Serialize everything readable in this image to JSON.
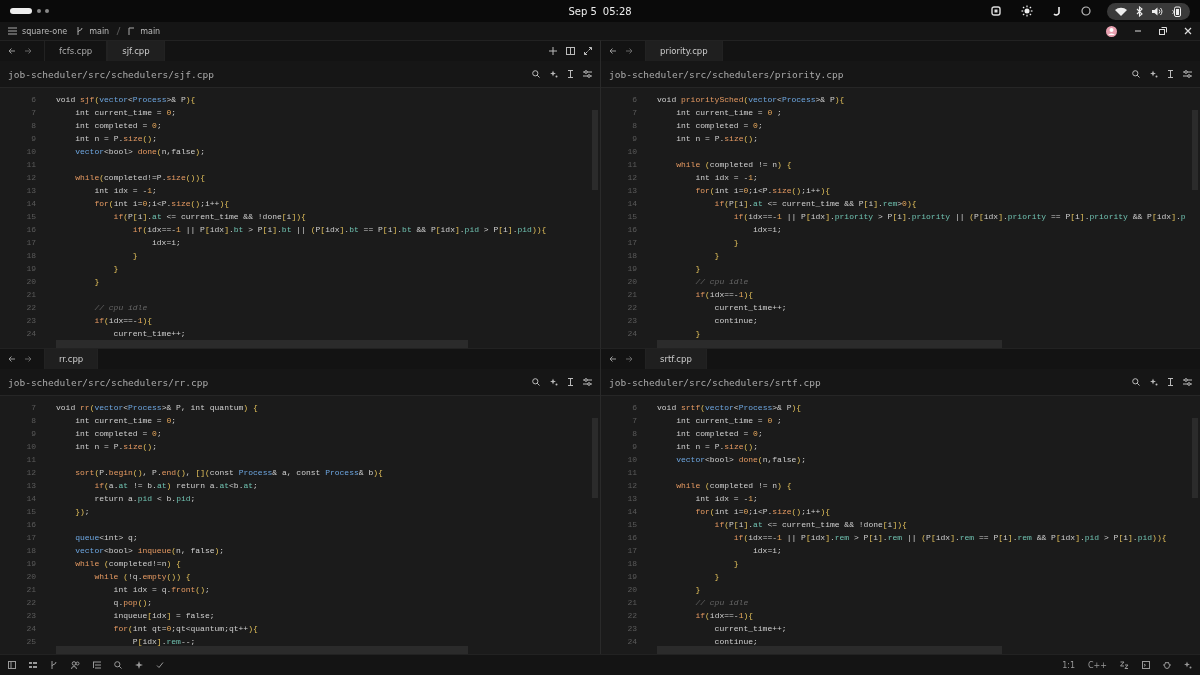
{
  "system_bar": {
    "date": "Sep 5",
    "time": "05:28"
  },
  "title_bar": {
    "project": "square-one",
    "branch": "main",
    "worktree": "main"
  },
  "panes": [
    {
      "tabs": [
        {
          "label": "fcfs.cpp",
          "selected": false
        },
        {
          "label": "sjf.cpp",
          "selected": true
        }
      ],
      "tab_actions": true,
      "path": "job-scheduler/src/schedulers/sjf.cpp",
      "lines": [
        {
          "number": "6",
          "code": "void sjf(vector<Process>& P){"
        },
        {
          "number": "7",
          "code": "    int current_time = 0;"
        },
        {
          "number": "8",
          "code": "    int completed = 0;"
        },
        {
          "number": "9",
          "code": "    int n = P.size();"
        },
        {
          "number": "10",
          "code": "    vector<bool> done(n,false);"
        },
        {
          "number": "11"
        },
        {
          "number": "12",
          "code": "    while(completed!=P.size()){"
        },
        {
          "number": "13",
          "code": "        int idx = -1;"
        },
        {
          "number": "14",
          "code": "        for(int i=0;i<P.size();i++){"
        },
        {
          "number": "15",
          "code": "            if(P[i].at <= current_time && !done[i]){"
        },
        {
          "number": "16",
          "code": "                if(idx==-1 || P[idx].bt > P[i].bt || (P[idx].bt == P[i].bt && P[idx].pid > P[i].pid)){"
        },
        {
          "number": "17",
          "code": "                    idx=i;"
        },
        {
          "number": "18",
          "code": "                }"
        },
        {
          "number": "19",
          "code": "            }"
        },
        {
          "number": "20",
          "code": "        }"
        },
        {
          "number": "21"
        },
        {
          "number": "22",
          "code": "        // cpu idle"
        },
        {
          "number": "23",
          "code": "        if(idx==-1){"
        },
        {
          "number": "24",
          "code": "            current_time++;"
        }
      ]
    },
    {
      "tabs": [
        {
          "label": "priority.cpp",
          "selected": true
        }
      ],
      "tab_actions": false,
      "path": "job-scheduler/src/schedulers/priority.cpp",
      "lines": [
        {
          "number": "6",
          "code": "void prioritySched(vector<Process>& P){"
        },
        {
          "number": "7",
          "code": "    int current_time = 0 ;"
        },
        {
          "number": "8",
          "code": "    int completed = 0;"
        },
        {
          "number": "9",
          "code": "    int n = P.size();"
        },
        {
          "number": "10"
        },
        {
          "number": "11",
          "code": "    while (completed != n) {"
        },
        {
          "number": "12",
          "code": "        int idx = -1;"
        },
        {
          "number": "13",
          "code": "        for(int i=0;i<P.size();i++){"
        },
        {
          "number": "14",
          "code": "            if(P[i].at <= current_time && P[i].rem>0){"
        },
        {
          "number": "15",
          "code": "                if(idx==-1 || P[idx].priority > P[i].priority || (P[idx].priority == P[i].priority && P[idx].p"
        },
        {
          "number": "16",
          "code": "                    idx=i;"
        },
        {
          "number": "17",
          "code": "                }"
        },
        {
          "number": "18",
          "code": "            }"
        },
        {
          "number": "19",
          "code": "        }"
        },
        {
          "number": "20",
          "code": "        // cpu idle"
        },
        {
          "number": "21",
          "code": "        if(idx==-1){"
        },
        {
          "number": "22",
          "code": "            current_time++;"
        },
        {
          "number": "23",
          "code": "            continue;"
        },
        {
          "number": "24",
          "code": "        }"
        }
      ]
    },
    {
      "tabs": [
        {
          "label": "rr.cpp",
          "selected": true
        }
      ],
      "tab_actions": false,
      "path": "job-scheduler/src/schedulers/rr.cpp",
      "lines": [
        {
          "number": "7",
          "code": "void rr(vector<Process>& P, int quantum) {"
        },
        {
          "number": "8",
          "code": "    int current_time = 0;"
        },
        {
          "number": "9",
          "code": "    int completed = 0;"
        },
        {
          "number": "10",
          "code": "    int n = P.size();"
        },
        {
          "number": "11"
        },
        {
          "number": "12",
          "code": "    sort(P.begin(), P.end(), [](const Process& a, const Process& b){"
        },
        {
          "number": "13",
          "code": "        if(a.at != b.at) return a.at<b.at;"
        },
        {
          "number": "14",
          "code": "        return a.pid < b.pid;"
        },
        {
          "number": "15",
          "code": "    });"
        },
        {
          "number": "16"
        },
        {
          "number": "17",
          "code": "    queue<int> q;"
        },
        {
          "number": "18",
          "code": "    vector<bool> inqueue(n, false);"
        },
        {
          "number": "19",
          "code": "    while (completed!=n) {"
        },
        {
          "number": "20",
          "code": "        while (!q.empty()) {"
        },
        {
          "number": "21",
          "code": "            int idx = q.front();"
        },
        {
          "number": "22",
          "code": "            q.pop();"
        },
        {
          "number": "23",
          "code": "            inqueue[idx] = false;"
        },
        {
          "number": "24",
          "code": "            for(int qt=0;qt<quantum;qt++){"
        },
        {
          "number": "25",
          "code": "                P[idx].rem--;"
        }
      ]
    },
    {
      "tabs": [
        {
          "label": "srtf.cpp",
          "selected": true
        }
      ],
      "tab_actions": false,
      "path": "job-scheduler/src/schedulers/srtf.cpp",
      "lines": [
        {
          "number": "6",
          "code": "void srtf(vector<Process>& P){"
        },
        {
          "number": "7",
          "code": "    int current_time = 0 ;"
        },
        {
          "number": "8",
          "code": "    int completed = 0;"
        },
        {
          "number": "9",
          "code": "    int n = P.size();"
        },
        {
          "number": "10",
          "code": "    vector<bool> done(n,false);"
        },
        {
          "number": "11"
        },
        {
          "number": "12",
          "code": "    while (completed != n) {"
        },
        {
          "number": "13",
          "code": "        int idx = -1;"
        },
        {
          "number": "14",
          "code": "        for(int i=0;i<P.size();i++){"
        },
        {
          "number": "15",
          "code": "            if(P[i].at <= current_time && !done[i]){"
        },
        {
          "number": "16",
          "code": "                if(idx==-1 || P[idx].rem > P[i].rem || (P[idx].rem == P[i].rem && P[idx].pid > P[i].pid)){"
        },
        {
          "number": "17",
          "code": "                    idx=i;"
        },
        {
          "number": "18",
          "code": "                }"
        },
        {
          "number": "19",
          "code": "            }"
        },
        {
          "number": "20",
          "code": "        }"
        },
        {
          "number": "21",
          "code": "        // cpu idle"
        },
        {
          "number": "22",
          "code": "        if(idx==-1){"
        },
        {
          "number": "23",
          "code": "            current_time++;"
        },
        {
          "number": "24",
          "code": "            continue;"
        }
      ]
    }
  ],
  "status_bar": {
    "position": "1:1",
    "language": "C++"
  }
}
